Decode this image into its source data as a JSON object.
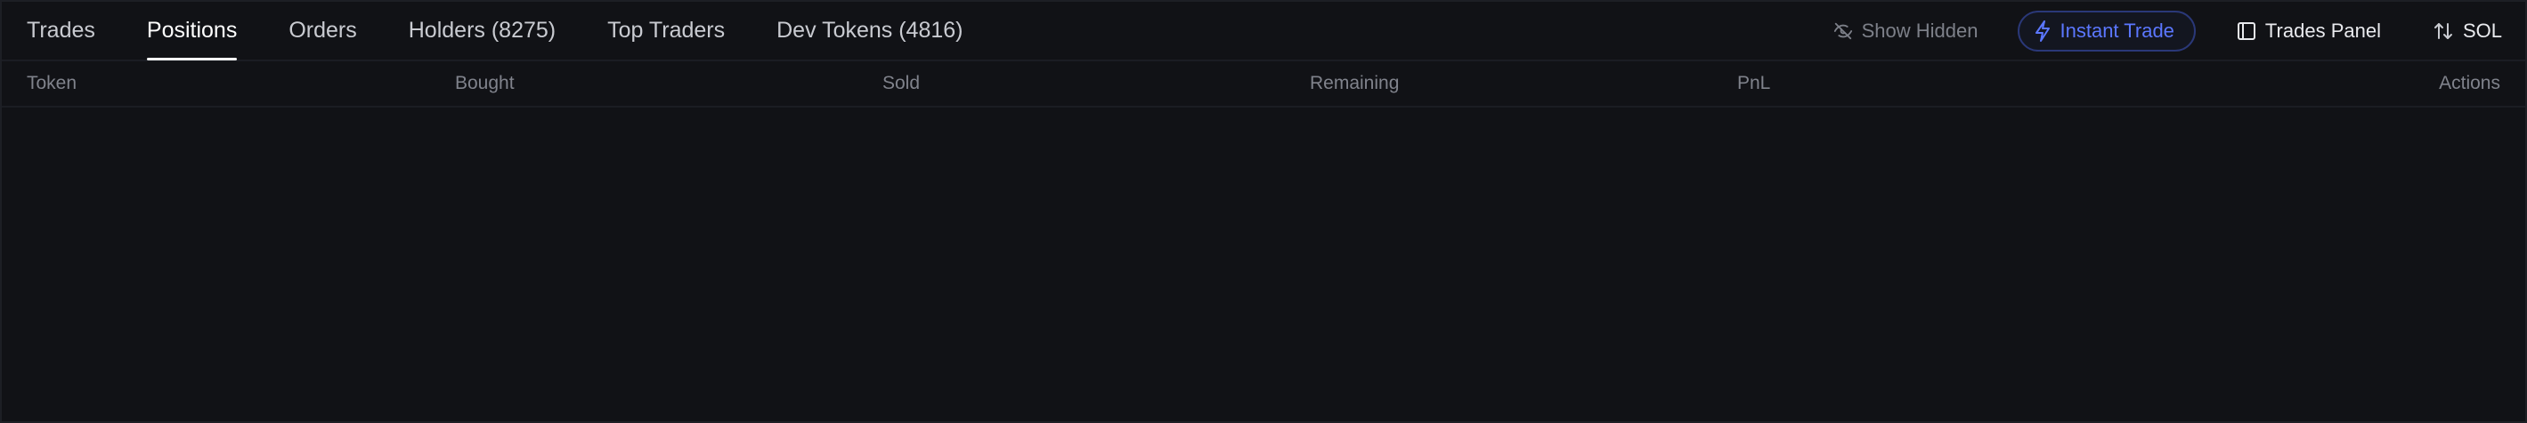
{
  "tabs": [
    {
      "label": "Trades",
      "active": false
    },
    {
      "label": "Positions",
      "active": true
    },
    {
      "label": "Orders",
      "active": false
    },
    {
      "label": "Holders (8275)",
      "active": false
    },
    {
      "label": "Top Traders",
      "active": false
    },
    {
      "label": "Dev Tokens (4816)",
      "active": false
    }
  ],
  "controls": {
    "show_hidden": {
      "label": "Show Hidden",
      "icon": "eye-off-icon"
    },
    "instant_trade": {
      "label": "Instant Trade",
      "icon": "lightning-icon",
      "color": "#5b77ff"
    },
    "trades_panel": {
      "label": "Trades Panel",
      "icon": "panel-icon"
    },
    "currency": {
      "label": "SOL",
      "icon": "swap-arrows-icon"
    }
  },
  "columns": [
    "Token",
    "Bought",
    "Sold",
    "Remaining",
    "PnL",
    "Actions"
  ],
  "rows": [],
  "colors": {
    "background": "#111216",
    "border": "#1b1d23",
    "accent": "#5b77ff",
    "muted_text": "#80838c"
  }
}
